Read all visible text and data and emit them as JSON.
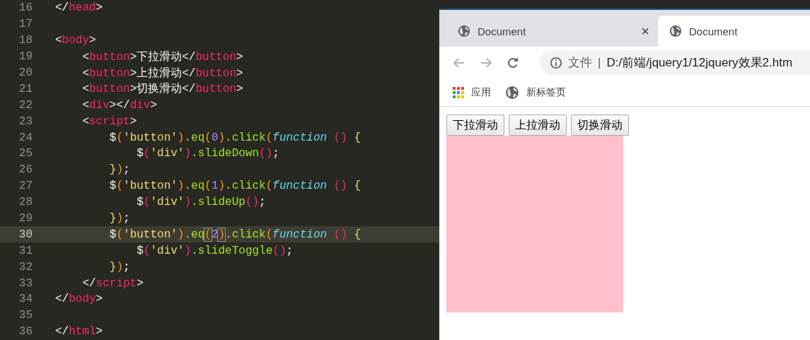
{
  "editor": {
    "lines": [
      {
        "n": "16",
        "current": false,
        "tokens": [
          {
            "t": "</",
            "kind": "punct"
          },
          {
            "t": "head",
            "kind": "tag"
          },
          {
            "t": ">",
            "kind": "punct"
          }
        ]
      },
      {
        "n": "17",
        "current": false
      },
      {
        "n": "18",
        "current": false,
        "tokens": [
          {
            "t": "<",
            "kind": "punct"
          },
          {
            "t": "body",
            "kind": "tag"
          },
          {
            "t": ">",
            "kind": "punct"
          }
        ]
      },
      {
        "n": "19",
        "current": false,
        "tokens": [
          {
            "t": "    <",
            "kind": "punct"
          },
          {
            "t": "button",
            "kind": "tag"
          },
          {
            "t": ">下拉滑动</",
            "kind": "punct"
          },
          {
            "t": "button",
            "kind": "tag"
          },
          {
            "t": ">",
            "kind": "punct"
          }
        ]
      },
      {
        "n": "20",
        "current": false,
        "tokens": [
          {
            "t": "    <",
            "kind": "punct"
          },
          {
            "t": "button",
            "kind": "tag"
          },
          {
            "t": ">上拉滑动</",
            "kind": "punct"
          },
          {
            "t": "button",
            "kind": "tag"
          },
          {
            "t": ">",
            "kind": "punct"
          }
        ]
      },
      {
        "n": "21",
        "current": false,
        "tokens": [
          {
            "t": "    <",
            "kind": "punct"
          },
          {
            "t": "button",
            "kind": "tag"
          },
          {
            "t": ">切换滑动</",
            "kind": "punct"
          },
          {
            "t": "button",
            "kind": "tag"
          },
          {
            "t": ">",
            "kind": "punct"
          }
        ]
      },
      {
        "n": "22",
        "current": false,
        "tokens": [
          {
            "t": "    <",
            "kind": "punct"
          },
          {
            "t": "div",
            "kind": "tag"
          },
          {
            "t": "></",
            "kind": "punct"
          },
          {
            "t": "div",
            "kind": "tag"
          },
          {
            "t": ">",
            "kind": "punct"
          }
        ]
      },
      {
        "n": "23",
        "current": false,
        "tokens": [
          {
            "t": "    <",
            "kind": "punct"
          },
          {
            "t": "script",
            "kind": "tag"
          },
          {
            "t": ">",
            "kind": "punct"
          }
        ]
      },
      {
        "n": "24",
        "current": false,
        "tokens": [
          {
            "t": "        $",
            "kind": "punct"
          },
          {
            "t": "(",
            "kind": "paren1"
          },
          {
            "t": "'button'",
            "kind": "string"
          },
          {
            "t": ")",
            "kind": "paren1"
          },
          {
            "t": ".eq",
            "kind": "method"
          },
          {
            "t": "(",
            "kind": "paren1"
          },
          {
            "t": "0",
            "kind": "number"
          },
          {
            "t": ")",
            "kind": "paren1"
          },
          {
            "t": ".click",
            "kind": "method"
          },
          {
            "t": "(",
            "kind": "paren1"
          },
          {
            "t": "function",
            "kind": "keyword"
          },
          {
            "t": " ()",
            "kind": "paren2"
          },
          {
            "t": " {",
            "kind": "brace"
          }
        ]
      },
      {
        "n": "25",
        "current": false,
        "tokens": [
          {
            "t": "            $",
            "kind": "punct"
          },
          {
            "t": "(",
            "kind": "paren2"
          },
          {
            "t": "'div'",
            "kind": "string"
          },
          {
            "t": ")",
            "kind": "paren2"
          },
          {
            "t": ".slideDown",
            "kind": "method"
          },
          {
            "t": "()",
            "kind": "paren2"
          },
          {
            "t": ";",
            "kind": "punct"
          }
        ]
      },
      {
        "n": "26",
        "current": false,
        "tokens": [
          {
            "t": "        }",
            "kind": "brace"
          },
          {
            "t": ")",
            "kind": "paren1"
          },
          {
            "t": ";",
            "kind": "punct"
          }
        ]
      },
      {
        "n": "27",
        "current": false,
        "tokens": [
          {
            "t": "        $",
            "kind": "punct"
          },
          {
            "t": "(",
            "kind": "paren1"
          },
          {
            "t": "'button'",
            "kind": "string"
          },
          {
            "t": ")",
            "kind": "paren1"
          },
          {
            "t": ".eq",
            "kind": "method"
          },
          {
            "t": "(",
            "kind": "paren1"
          },
          {
            "t": "1",
            "kind": "number"
          },
          {
            "t": ")",
            "kind": "paren1"
          },
          {
            "t": ".click",
            "kind": "method"
          },
          {
            "t": "(",
            "kind": "paren1"
          },
          {
            "t": "function",
            "kind": "keyword"
          },
          {
            "t": " ()",
            "kind": "paren2"
          },
          {
            "t": " {",
            "kind": "brace"
          }
        ]
      },
      {
        "n": "28",
        "current": false,
        "tokens": [
          {
            "t": "            $",
            "kind": "punct"
          },
          {
            "t": "(",
            "kind": "paren2"
          },
          {
            "t": "'div'",
            "kind": "string"
          },
          {
            "t": ")",
            "kind": "paren2"
          },
          {
            "t": ".slideUp",
            "kind": "method"
          },
          {
            "t": "()",
            "kind": "paren2"
          },
          {
            "t": ";",
            "kind": "punct"
          }
        ]
      },
      {
        "n": "29",
        "current": false,
        "tokens": [
          {
            "t": "        }",
            "kind": "brace"
          },
          {
            "t": ")",
            "kind": "paren1"
          },
          {
            "t": ";",
            "kind": "punct"
          }
        ]
      },
      {
        "n": "30",
        "current": true,
        "tokens": [
          {
            "t": "        $",
            "kind": "punct"
          },
          {
            "t": "(",
            "kind": "paren1"
          },
          {
            "t": "'button'",
            "kind": "string"
          },
          {
            "t": ")",
            "kind": "paren1"
          },
          {
            "t": ".eq",
            "kind": "method"
          },
          {
            "t": "(",
            "kind": "paren1",
            "boxed": true
          },
          {
            "t": "2",
            "kind": "number"
          },
          {
            "t": ")",
            "kind": "paren1",
            "boxed": true
          },
          {
            "t": ".click",
            "kind": "method"
          },
          {
            "t": "(",
            "kind": "paren1"
          },
          {
            "t": "function",
            "kind": "keyword"
          },
          {
            "t": " ()",
            "kind": "paren2"
          },
          {
            "t": " {",
            "kind": "brace"
          }
        ]
      },
      {
        "n": "31",
        "current": false,
        "tokens": [
          {
            "t": "            $",
            "kind": "punct"
          },
          {
            "t": "(",
            "kind": "paren2"
          },
          {
            "t": "'div'",
            "kind": "string"
          },
          {
            "t": ")",
            "kind": "paren2"
          },
          {
            "t": ".slideToggle",
            "kind": "method"
          },
          {
            "t": "()",
            "kind": "paren2"
          },
          {
            "t": ";",
            "kind": "punct"
          }
        ]
      },
      {
        "n": "32",
        "current": false,
        "tokens": [
          {
            "t": "        }",
            "kind": "brace"
          },
          {
            "t": ")",
            "kind": "paren1"
          },
          {
            "t": ";",
            "kind": "punct"
          }
        ]
      },
      {
        "n": "33",
        "current": false,
        "tokens": [
          {
            "t": "    </",
            "kind": "punct"
          },
          {
            "t": "script",
            "kind": "tag"
          },
          {
            "t": ">",
            "kind": "punct"
          }
        ]
      },
      {
        "n": "34",
        "current": false,
        "tokens": [
          {
            "t": "</",
            "kind": "punct"
          },
          {
            "t": "body",
            "kind": "tag"
          },
          {
            "t": ">",
            "kind": "punct"
          }
        ]
      },
      {
        "n": "35",
        "current": false
      },
      {
        "n": "36",
        "current": false,
        "tokens": [
          {
            "t": "</",
            "kind": "punct"
          },
          {
            "t": "html",
            "kind": "tag"
          },
          {
            "t": ">",
            "kind": "punct"
          }
        ]
      }
    ]
  },
  "browser": {
    "tabs": [
      {
        "title": "Document",
        "close": "×",
        "selected": false
      },
      {
        "title": "Document",
        "selected": true
      }
    ],
    "address": {
      "scheme": "文件",
      "separator": "|",
      "url": "D:/前端/jquery1/12jquery效果2.htm"
    },
    "bookmarks": [
      {
        "kind": "apps",
        "label": "应用"
      },
      {
        "kind": "page",
        "label": "新标签页"
      }
    ],
    "page": {
      "buttons": [
        "下拉滑动",
        "上拉滑动",
        "切换滑动"
      ],
      "box": {
        "color": "#ffc0cb"
      }
    }
  }
}
